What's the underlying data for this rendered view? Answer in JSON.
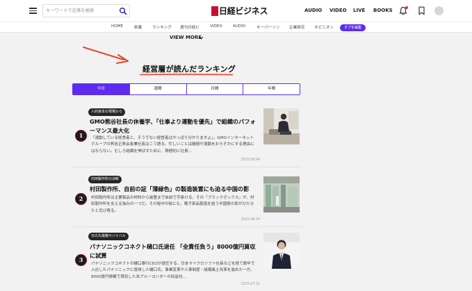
{
  "header": {
    "search": {
      "placeholder": "キーワードで記事を検索",
      "value": ""
    },
    "logo": "日経ビジネス",
    "nav": [
      "AUDIO",
      "VIDEO",
      "LIVE",
      "BOOKS"
    ]
  },
  "categories": [
    "HOME",
    "新着",
    "ランキング",
    "週刊日経ビ",
    "VIDEO",
    "AUDIO",
    "キーパーソン",
    "企業研究",
    "オピニオン"
  ],
  "category_action": "タブを編集",
  "view_more": "VIEW MORE",
  "ranking": {
    "title": "経営層が読んだランキング",
    "tabs": [
      "今日",
      "週間",
      "月間",
      "年間"
    ],
    "active_tab": 0
  },
  "articles": [
    {
      "rank": "1",
      "series": "人的資本の現場から",
      "title": "GMO熊谷社長の休養学、「仕事より運動を優先」で組織のパフォーマンス最大化",
      "excerpt": "「運動している経営者と、そうでない経営者はやっぱり分かりますよ」。GMOインターネットグループの熊谷正寿会長兼社長はこう語る。忙しいことは継続や運動をおろそかにする理由にはならない。むしろ組織を伸ばすために、積極的に社員…",
      "date": "2025.08.04"
    },
    {
      "rank": "2",
      "series": "村田製作所の決断",
      "title": "村田製作所、自前の証「薄緑色」の製造装置にも迫る中国の影",
      "excerpt": "村田製作所は主要製品の材料から装置まで自前で手掛ける。その「ブラックボックス」が、村田製作所を支える強みの一つだ。その秘中の秘にも、電子部品製造を狙う中国勢の影がひたひたと忍び寄る。",
      "date": "2025.08.04"
    },
    {
      "rank": "3",
      "series": "日の丸電機サバイバル",
      "title": "パナソニックコネクト樋口氏退任 「全責任負う」8000億円買収に試算",
      "excerpt": "パナソニックコネクトの樋口泰行CEOが退任する。日本マイクロソフト社長などを経て数年で入社したパナソニックに復帰した樋口氏。事業変革や人事制度・組織風土改革を進めた一方、8000億円規模で買収した米ブルーヨンダーの収益化…",
      "date": "2025.07.31"
    }
  ],
  "colors": {
    "accent": "#5b2cf0",
    "logo_red": "#c8102e",
    "rank_border": "#8a0f1f",
    "annotation": "#e8442c"
  },
  "icons": [
    "menu-icon",
    "search-icon",
    "bell-icon",
    "bookmark-icon",
    "avatar-icon",
    "chevron-down-icon",
    "annotation-arrow"
  ]
}
